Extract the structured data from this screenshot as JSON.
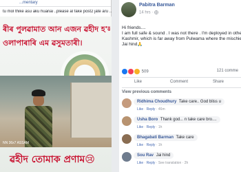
{
  "left_post": {
    "header": "...mentary",
    "caption": "tu mol thike asu aku huanai ..please al fake post2 jate aru ...",
    "poster_line1": "ৰীৰ পুলৱামাত আন এজন ৱহীদ হ'ল",
    "poster_line2": "ওলাপাৰাৰি এম ৱসুমতাৰী।",
    "photo_tag": "NN 36x7 ASSAM",
    "poster_line3": "ৱহীদ তোমাক প্ৰণাম😢"
  },
  "right_post": {
    "author": "Pabitra Barman",
    "time": "14 hrs ·",
    "body": [
      "Hi friends....",
      "I am full safe & sound . I was not there . I'm deployed in other dis",
      "Kashmir, which is far away from Pulwama where the mischief ha",
      "Jai hind🙏"
    ],
    "reaction_count": "509",
    "comments_count": "121 comme",
    "actions": {
      "like": "Like",
      "comment": "Comment",
      "share": "Share"
    },
    "previous_comments": "View previous comments",
    "comments": [
      {
        "name": "Ridhima Choudhury",
        "text": "Take care.. God bliss u",
        "meta_like": "Like",
        "meta_reply": "Reply",
        "meta_time": "46m",
        "avatar_color": "#c59b7d"
      },
      {
        "name": "Usha Boro",
        "text": "Thank god... n take care bro....",
        "meta_like": "Like",
        "meta_reply": "Reply",
        "meta_time": "1h",
        "avatar_color": "#b89370"
      },
      {
        "name": "Bhagabati Barman",
        "text": "Take care",
        "meta_like": "Like",
        "meta_reply": "Reply",
        "meta_time": "1h",
        "avatar_color": "#8a6d52"
      },
      {
        "name": "Sou Rav",
        "text": "Jai hind",
        "meta_like": "Like",
        "meta_reply": "Reply",
        "meta_time": "See translation · 2h",
        "avatar_color": "#6f7c8e"
      }
    ]
  }
}
